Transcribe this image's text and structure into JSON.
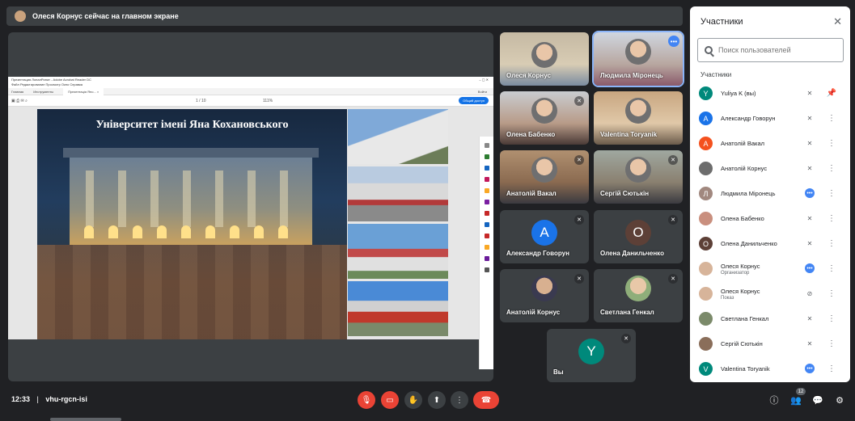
{
  "banner": {
    "text": "Олеся Корнус сейчас на главном экране"
  },
  "presentation": {
    "window_title": "Презентация ЛоналРинат - Adobe Acrobat Reader DC",
    "menu": "Файл  Редактирование  Просмотр  Окно  Справка",
    "tabs": [
      "Главная",
      "Инструменты",
      "Презентація Яно... ×"
    ],
    "login": "Войти",
    "page_indicator": "1 / 10",
    "zoom": "111%",
    "share_label": "Общий доступ",
    "slide_title": "Університет імені Яна Кохановського"
  },
  "tiles": [
    {
      "name": "Олеся Корнус",
      "type": "video"
    },
    {
      "name": "Людмила Міронець",
      "type": "video",
      "highlight": true
    },
    {
      "name": "Олена Бабенко",
      "type": "video",
      "muted": true
    },
    {
      "name": "Valentina Toryanik",
      "type": "video"
    },
    {
      "name": "Анатолій Вакал",
      "type": "video",
      "muted": true
    },
    {
      "name": "Сергій Сютькін",
      "type": "video",
      "muted": true
    },
    {
      "name": "Александр Говорун",
      "type": "avatar",
      "letter": "А",
      "color": "#1a73e8",
      "muted": true
    },
    {
      "name": "Олена Данильченко",
      "type": "avatar",
      "letter": "О",
      "color": "#5d4037",
      "muted": true
    },
    {
      "name": "Анатолій Корнус",
      "type": "photo",
      "muted": true
    },
    {
      "name": "Светлана Генкал",
      "type": "photo",
      "muted": true
    },
    {
      "name": "Вы",
      "type": "avatar",
      "letter": "Y",
      "color": "#00897b",
      "muted": true
    }
  ],
  "panel": {
    "title": "Участники",
    "search_placeholder": "Поиск пользователей",
    "section_label": "Участники",
    "participants": [
      {
        "name": "Yuliya K (вы)",
        "letter": "Y",
        "color": "#00897b",
        "status": "muted",
        "pin": true
      },
      {
        "name": "Александр Говорун",
        "letter": "А",
        "color": "#1a73e8",
        "status": "muted"
      },
      {
        "name": "Анатолій Вакал",
        "letter": "А",
        "color": "#f4511e",
        "status": "muted"
      },
      {
        "name": "Анатолій Корнус",
        "letter": "",
        "color": "#6d6d6d",
        "status": "muted"
      },
      {
        "name": "Людмила Міронець",
        "letter": "Л",
        "color": "#a1887f",
        "status": "speaking"
      },
      {
        "name": "Олена Бабенко",
        "letter": "",
        "color": "#c98f7e",
        "status": "muted"
      },
      {
        "name": "Олена Данильченко",
        "letter": "О",
        "color": "#5d4037",
        "status": "muted"
      },
      {
        "name": "Олеся Корнус",
        "role": "Организатор",
        "letter": "",
        "color": "#d7b49a",
        "status": "speaking"
      },
      {
        "name": "Олеся Корнус",
        "role": "Показ",
        "letter": "",
        "color": "#d7b49a",
        "status": "screen-off"
      },
      {
        "name": "Светлана Генкал",
        "letter": "",
        "color": "#7b8a6a",
        "status": "muted"
      },
      {
        "name": "Сергій Сютькін",
        "letter": "",
        "color": "#8a6e5a",
        "status": "muted"
      },
      {
        "name": "Valentina Toryanik",
        "letter": "V",
        "color": "#00897b",
        "status": "speaking"
      }
    ]
  },
  "bottom": {
    "time": "12:33",
    "separator": "|",
    "meeting_code": "vhu-rgcn-isi",
    "participant_count": "12"
  }
}
